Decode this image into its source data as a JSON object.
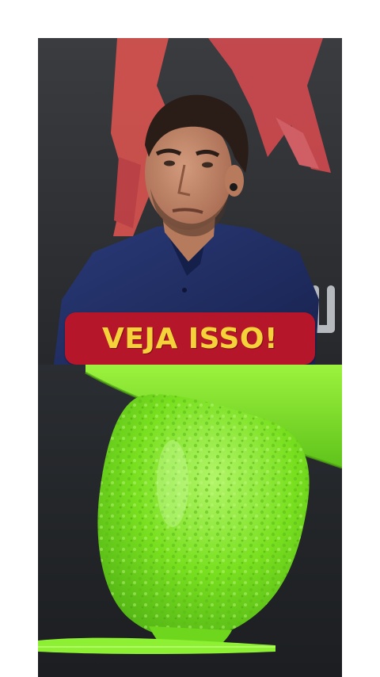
{
  "overlay": {
    "caption": "VEJA ISSO!"
  },
  "colors": {
    "caption_background": "#b5162a",
    "caption_text": "#f6d23a",
    "slime_green": "#7fe81e",
    "stage_background": "#2c2f34",
    "shirt_navy": "#1d2a5e"
  }
}
